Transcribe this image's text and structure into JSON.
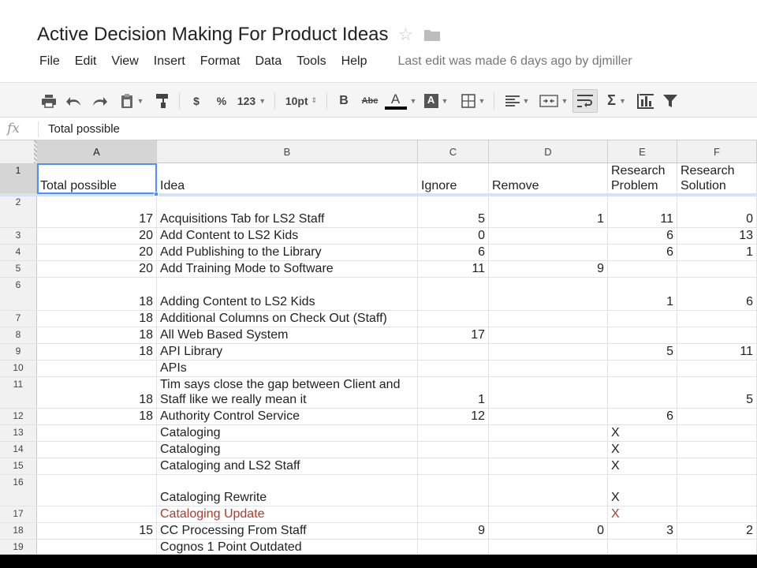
{
  "doc": {
    "title": "Active Decision Making For Product Ideas",
    "last_edit": "Last edit was made 6 days ago by djmiller"
  },
  "menu": [
    "File",
    "Edit",
    "View",
    "Insert",
    "Format",
    "Data",
    "Tools",
    "Help"
  ],
  "toolbar": {
    "currency": "$",
    "percent": "%",
    "number_format": "123",
    "font_size": "10pt",
    "bold": "B",
    "strike": "Abc",
    "text_color": "A",
    "fill_color": "A",
    "sum": "Σ"
  },
  "formula": {
    "fx": "fx",
    "value": "Total possible"
  },
  "columns": [
    "A",
    "B",
    "C",
    "D",
    "E",
    "F"
  ],
  "rows": [
    {
      "num": "1",
      "a": "Total possible",
      "b": "Idea",
      "c": "Ignore",
      "d": "Remove",
      "e": "Research Problem",
      "f": "Research Solution"
    },
    {
      "num": "2",
      "a": "17",
      "b": "Acquisitions Tab for LS2 Staff",
      "c": "5",
      "d": "1",
      "e": "11",
      "f": "0"
    },
    {
      "num": "3",
      "a": "20",
      "b": "Add Content to LS2 Kids",
      "c": "0",
      "d": "",
      "e": "6",
      "f": "13"
    },
    {
      "num": "4",
      "a": "20",
      "b": "Add Publishing to the Library",
      "c": "6",
      "d": "",
      "e": "6",
      "f": "1"
    },
    {
      "num": "5",
      "a": "20",
      "b": "Add Training Mode to Software",
      "c": "11",
      "d": "9",
      "e": "",
      "f": ""
    },
    {
      "num": "6",
      "a": "18",
      "b": "Adding Content to LS2 Kids",
      "c": "",
      "d": "",
      "e": "1",
      "f": "6"
    },
    {
      "num": "7",
      "a": "18",
      "b": "Additional Columns on Check Out (Staff)",
      "c": "",
      "d": "",
      "e": "",
      "f": ""
    },
    {
      "num": "8",
      "a": "18",
      "b": "All Web Based System",
      "c": "17",
      "d": "",
      "e": "",
      "f": ""
    },
    {
      "num": "9",
      "a": "18",
      "b": "API Library",
      "c": "",
      "d": "",
      "e": "5",
      "f": "11"
    },
    {
      "num": "10",
      "a": "",
      "b": "APIs",
      "c": "",
      "d": "",
      "e": "",
      "f": ""
    },
    {
      "num": "11",
      "a": "18",
      "b": "Tim says close the gap between Client and Staff like we really mean it",
      "c": "1",
      "d": "",
      "e": "",
      "f": "5"
    },
    {
      "num": "12",
      "a": "18",
      "b": "Authority Control Service",
      "c": "12",
      "d": "",
      "e": "6",
      "f": ""
    },
    {
      "num": "13",
      "a": "",
      "b": "Cataloging",
      "c": "",
      "d": "",
      "e": "X",
      "f": ""
    },
    {
      "num": "14",
      "a": "",
      "b": "Cataloging",
      "c": "",
      "d": "",
      "e": "X",
      "f": ""
    },
    {
      "num": "15",
      "a": "",
      "b": "Cataloging and LS2 Staff",
      "c": "",
      "d": "",
      "e": "X",
      "f": ""
    },
    {
      "num": "16",
      "a": "",
      "b": "Cataloging Rewrite",
      "c": "",
      "d": "",
      "e": "X",
      "f": ""
    },
    {
      "num": "17",
      "a": "",
      "b": "Cataloging Update",
      "c": "",
      "d": "",
      "e": "X",
      "f": ""
    },
    {
      "num": "18",
      "a": "15",
      "b": "CC Processing From Staff",
      "c": "9",
      "d": "0",
      "e": "3",
      "f": "2"
    },
    {
      "num": "19",
      "a": "",
      "b": "Cognos 1 Point Outdated",
      "c": "",
      "d": "",
      "e": "",
      "f": ""
    }
  ],
  "colors": {
    "selection": "#4d90fe",
    "red_text": "#b03a2e"
  }
}
